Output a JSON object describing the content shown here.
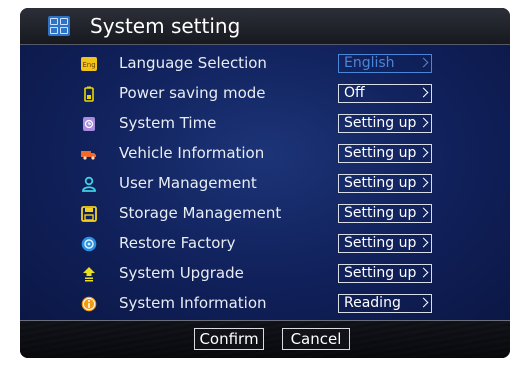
{
  "title": "System setting",
  "rows": [
    {
      "label": "Language Selection",
      "value": "English",
      "icon": "language-icon"
    },
    {
      "label": "Power saving mode",
      "value": "Off",
      "icon": "battery-icon"
    },
    {
      "label": "System Time",
      "value": "Setting up",
      "icon": "clock-icon"
    },
    {
      "label": "Vehicle Information",
      "value": "Setting up",
      "icon": "truck-icon"
    },
    {
      "label": "User Management",
      "value": "Setting up",
      "icon": "user-icon"
    },
    {
      "label": "Storage Management",
      "value": "Setting up",
      "icon": "save-icon"
    },
    {
      "label": "Restore Factory",
      "value": "Setting up",
      "icon": "restore-icon"
    },
    {
      "label": "System Upgrade",
      "value": "Setting up",
      "icon": "upgrade-icon"
    },
    {
      "label": "System Information",
      "value": "Reading",
      "icon": "info-icon"
    }
  ],
  "language_icon_text": "Eng",
  "footer": {
    "confirm_label": "Confirm",
    "cancel_label": "Cancel"
  },
  "colors": {
    "accent": "#4a86d8",
    "background": "#10205a",
    "title_bar": "#1f2128"
  }
}
